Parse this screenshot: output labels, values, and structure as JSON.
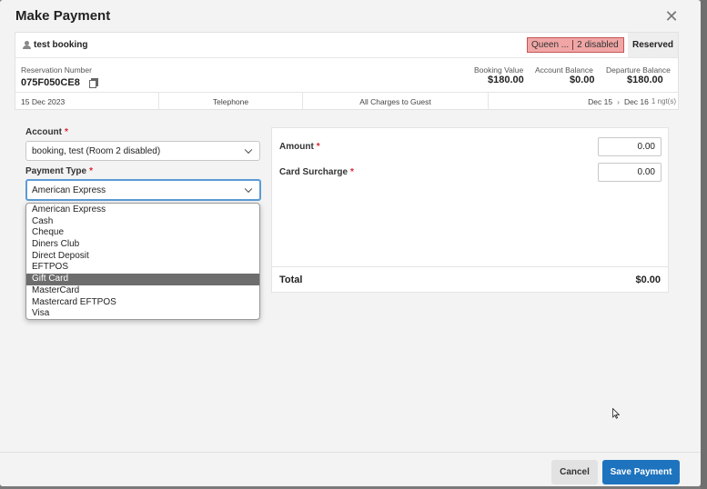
{
  "modal": {
    "title": "Make Payment"
  },
  "booking": {
    "name": "test booking",
    "room_tag": "Queen ...",
    "disabled_tag": "2 disabled",
    "status": "Reserved",
    "reservation_label": "Reservation Number",
    "reservation_number": "075F050CE8",
    "booking_value_label": "Booking Value",
    "booking_value": "$180.00",
    "account_balance_label": "Account Balance",
    "account_balance": "$0.00",
    "departure_balance_label": "Departure Balance",
    "departure_balance": "$180.00",
    "date": "15 Dec 2023",
    "source": "Telephone",
    "charges": "All Charges to Guest",
    "arrive": "Dec 15",
    "depart": "Dec 16",
    "nights": "1 ngt(s)"
  },
  "form": {
    "account_label": "Account",
    "account_value": "booking, test (Room 2 disabled)",
    "payment_type_label": "Payment Type",
    "payment_type_value": "American Express",
    "amount_label": "Amount",
    "amount_value": "0.00",
    "surcharge_label": "Card Surcharge",
    "surcharge_value": "0.00",
    "total_label": "Total",
    "total_value": "$0.00",
    "required_mark": "*"
  },
  "payment_options": [
    "American Express",
    "Cash",
    "Cheque",
    "Diners Club",
    "Direct Deposit",
    "EFTPOS",
    "Gift Card",
    "MasterCard",
    "Mastercard EFTPOS",
    "Visa"
  ],
  "highlighted_option": "Gift Card",
  "footer": {
    "cancel_label": "Cancel",
    "save_label": "Save Payment"
  },
  "colors": {
    "primary": "#1e73be",
    "tag_red": "#f1a6a6",
    "highlight": "#6d6d6d"
  }
}
